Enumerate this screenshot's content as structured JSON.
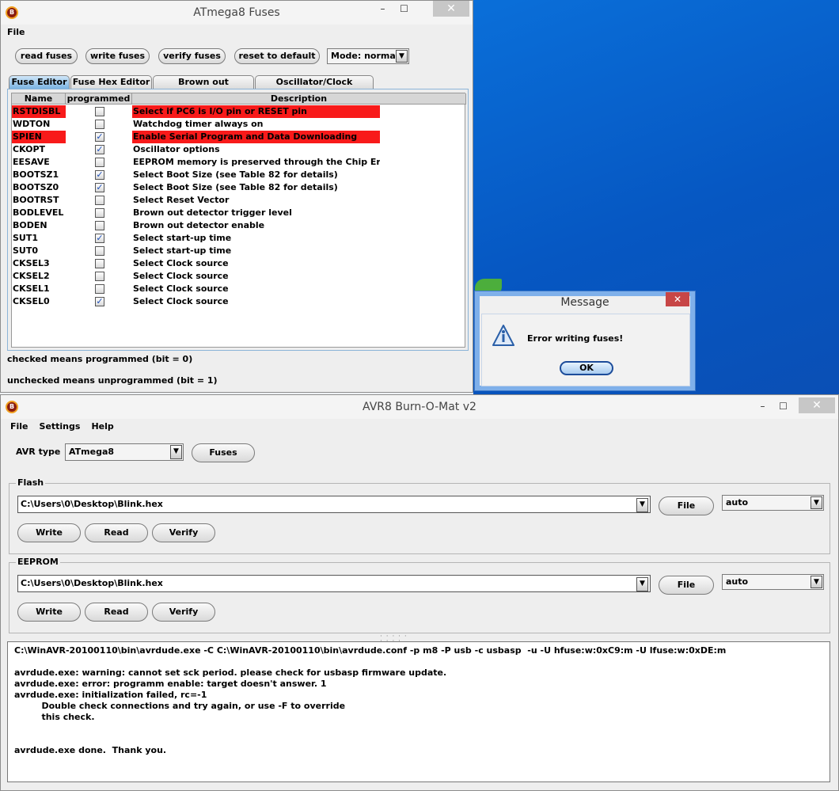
{
  "fuses_window": {
    "title": "ATmega8 Fuses",
    "menu": [
      "File"
    ],
    "buttons": {
      "read": "read fuses",
      "write": "write fuses",
      "verify": "verify fuses",
      "reset": "reset to default"
    },
    "mode_select": "Mode: normal",
    "tabs": [
      "Fuse Editor",
      "Fuse Hex Editor",
      "Brown out detection",
      "Oscillator/Clock Options"
    ],
    "active_tab": "Fuse Editor",
    "table": {
      "headers": [
        "Name",
        "programmed",
        "Description"
      ],
      "rows": [
        {
          "name": "RSTDISBL",
          "checked": false,
          "desc": "Select if PC6 is I/O pin or RESET pin",
          "highlight": true
        },
        {
          "name": "WDTON",
          "checked": false,
          "desc": "Watchdog timer always on",
          "highlight": false
        },
        {
          "name": "SPIEN",
          "checked": true,
          "desc": "Enable Serial Program and Data Downloading",
          "highlight": true
        },
        {
          "name": "CKOPT",
          "checked": true,
          "desc": "Oscillator options",
          "highlight": false
        },
        {
          "name": "EESAVE",
          "checked": false,
          "desc": "EEPROM memory is preserved through the Chip Erase",
          "highlight": false
        },
        {
          "name": "BOOTSZ1",
          "checked": true,
          "desc": "Select Boot Size (see Table 82 for details)",
          "highlight": false
        },
        {
          "name": "BOOTSZ0",
          "checked": true,
          "desc": "Select Boot Size (see Table 82 for details)",
          "highlight": false
        },
        {
          "name": "BOOTRST",
          "checked": false,
          "desc": "Select Reset Vector",
          "highlight": false
        },
        {
          "name": "BODLEVEL",
          "checked": false,
          "desc": "Brown out detector trigger level",
          "highlight": false
        },
        {
          "name": "BODEN",
          "checked": false,
          "desc": "Brown out detector enable",
          "highlight": false
        },
        {
          "name": "SUT1",
          "checked": true,
          "desc": "Select start-up time",
          "highlight": false
        },
        {
          "name": "SUT0",
          "checked": false,
          "desc": "Select start-up time",
          "highlight": false
        },
        {
          "name": "CKSEL3",
          "checked": false,
          "desc": "Select Clock source",
          "highlight": false
        },
        {
          "name": "CKSEL2",
          "checked": false,
          "desc": "Select Clock source",
          "highlight": false
        },
        {
          "name": "CKSEL1",
          "checked": false,
          "desc": "Select Clock source",
          "highlight": false
        },
        {
          "name": "CKSEL0",
          "checked": true,
          "desc": "Select Clock source",
          "highlight": false
        }
      ]
    },
    "note_checked": "checked means programmed (bit = 0)",
    "note_unchecked": "unchecked means unprogrammed (bit = 1)"
  },
  "message_dialog": {
    "title": "Message",
    "text": "Error writing fuses!",
    "ok": "OK"
  },
  "burnomat_window": {
    "title": "AVR8 Burn-O-Mat v2",
    "menu": [
      "File",
      "Settings",
      "Help"
    ],
    "avr_type_label": "AVR type",
    "avr_type_value": "ATmega8",
    "fuses_button": "Fuses",
    "flash": {
      "label": "Flash",
      "path": "C:\\Users\\0\\Desktop\\Blink.hex",
      "file_button": "File",
      "format": "auto",
      "write": "Write",
      "read": "Read",
      "verify": "Verify"
    },
    "eeprom": {
      "label": "EEPROM",
      "path": "C:\\Users\\0\\Desktop\\Blink.hex",
      "file_button": "File",
      "format": "auto",
      "write": "Write",
      "read": "Read",
      "verify": "Verify"
    },
    "log": [
      "C:\\WinAVR-20100110\\bin\\avrdude.exe -C C:\\WinAVR-20100110\\bin\\avrdude.conf -p m8 -P usb -c usbasp  -u -U hfuse:w:0xC9:m -U lfuse:w:0xDE:m",
      "",
      "avrdude.exe: warning: cannot set sck period. please check for usbasp firmware update.",
      "avrdude.exe: error: programm enable: target doesn't answer. 1",
      "avrdude.exe: initialization failed, rc=-1",
      "         Double check connections and try again, or use -F to override",
      "         this check.",
      "",
      "",
      "avrdude.exe done.  Thank you."
    ]
  },
  "colors": {
    "highlight_red": "#f81a1a",
    "tab_active": "#7bb3e2",
    "desktop_blue": "#0a6fd9"
  }
}
